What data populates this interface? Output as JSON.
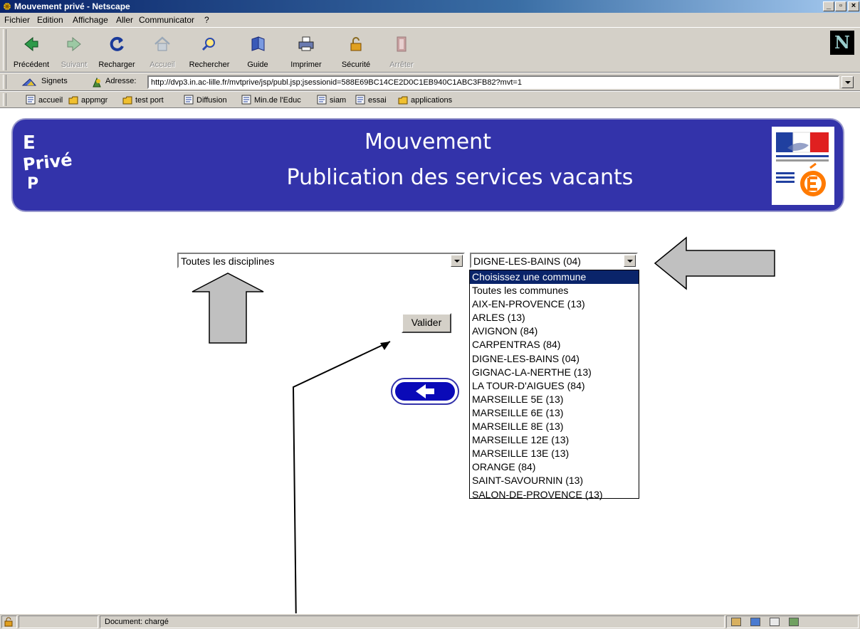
{
  "window": {
    "title": "Mouvement privé - Netscape"
  },
  "menu": [
    "Fichier",
    "Edition",
    "Affichage",
    "Aller",
    "Communicator",
    "?"
  ],
  "toolbar": {
    "back": "Précédent",
    "forward": "Suivant",
    "reload": "Recharger",
    "home": "Accueil",
    "search": "Rechercher",
    "guide": "Guide",
    "print": "Imprimer",
    "security": "Sécurité",
    "stop": "Arrêter"
  },
  "location": {
    "bookmarks_label": "Signets",
    "address_label": "Adresse:",
    "url": "http://dvp3.in.ac-lille.fr/mvtprive/jsp/publ.jsp;jsessionid=588E69BC14CE2D0C1EB940C1ABC3FB82?mvt=1"
  },
  "personal_toolbar": [
    "accueil",
    "appmgr",
    "test port",
    "Diffusion",
    "Min.de l'Educ",
    "siam",
    "essai",
    "applications"
  ],
  "banner": {
    "logo_letters": [
      "E",
      "Privé",
      "P"
    ],
    "title": "Mouvement",
    "subtitle": "Publication des services vacants"
  },
  "form": {
    "discipline_selected": "Toutes les disciplines",
    "commune_selected": "DIGNE-LES-BAINS (04)",
    "commune_options": [
      "Choisissez une commune",
      "Toutes les communes",
      "AIX-EN-PROVENCE (13)",
      "ARLES (13)",
      "AVIGNON (84)",
      "CARPENTRAS (84)",
      "DIGNE-LES-BAINS (04)",
      "GIGNAC-LA-NERTHE (13)",
      "LA TOUR-D'AIGUES (84)",
      "MARSEILLE 5E (13)",
      "MARSEILLE 6E (13)",
      "MARSEILLE 8E (13)",
      "MARSEILLE 12E (13)",
      "MARSEILLE 13E (13)",
      "ORANGE (84)",
      "SAINT-SAVOURNIN (13)",
      "SALON-DE-PROVENCE (13)"
    ],
    "highlighted_option": "Choisissez une commune",
    "submit": "Valider"
  },
  "status": {
    "text": "Document: chargé"
  },
  "colors": {
    "banner": "#3333aa",
    "titlebar": "#0a246a",
    "highlight": "#0a246a"
  }
}
